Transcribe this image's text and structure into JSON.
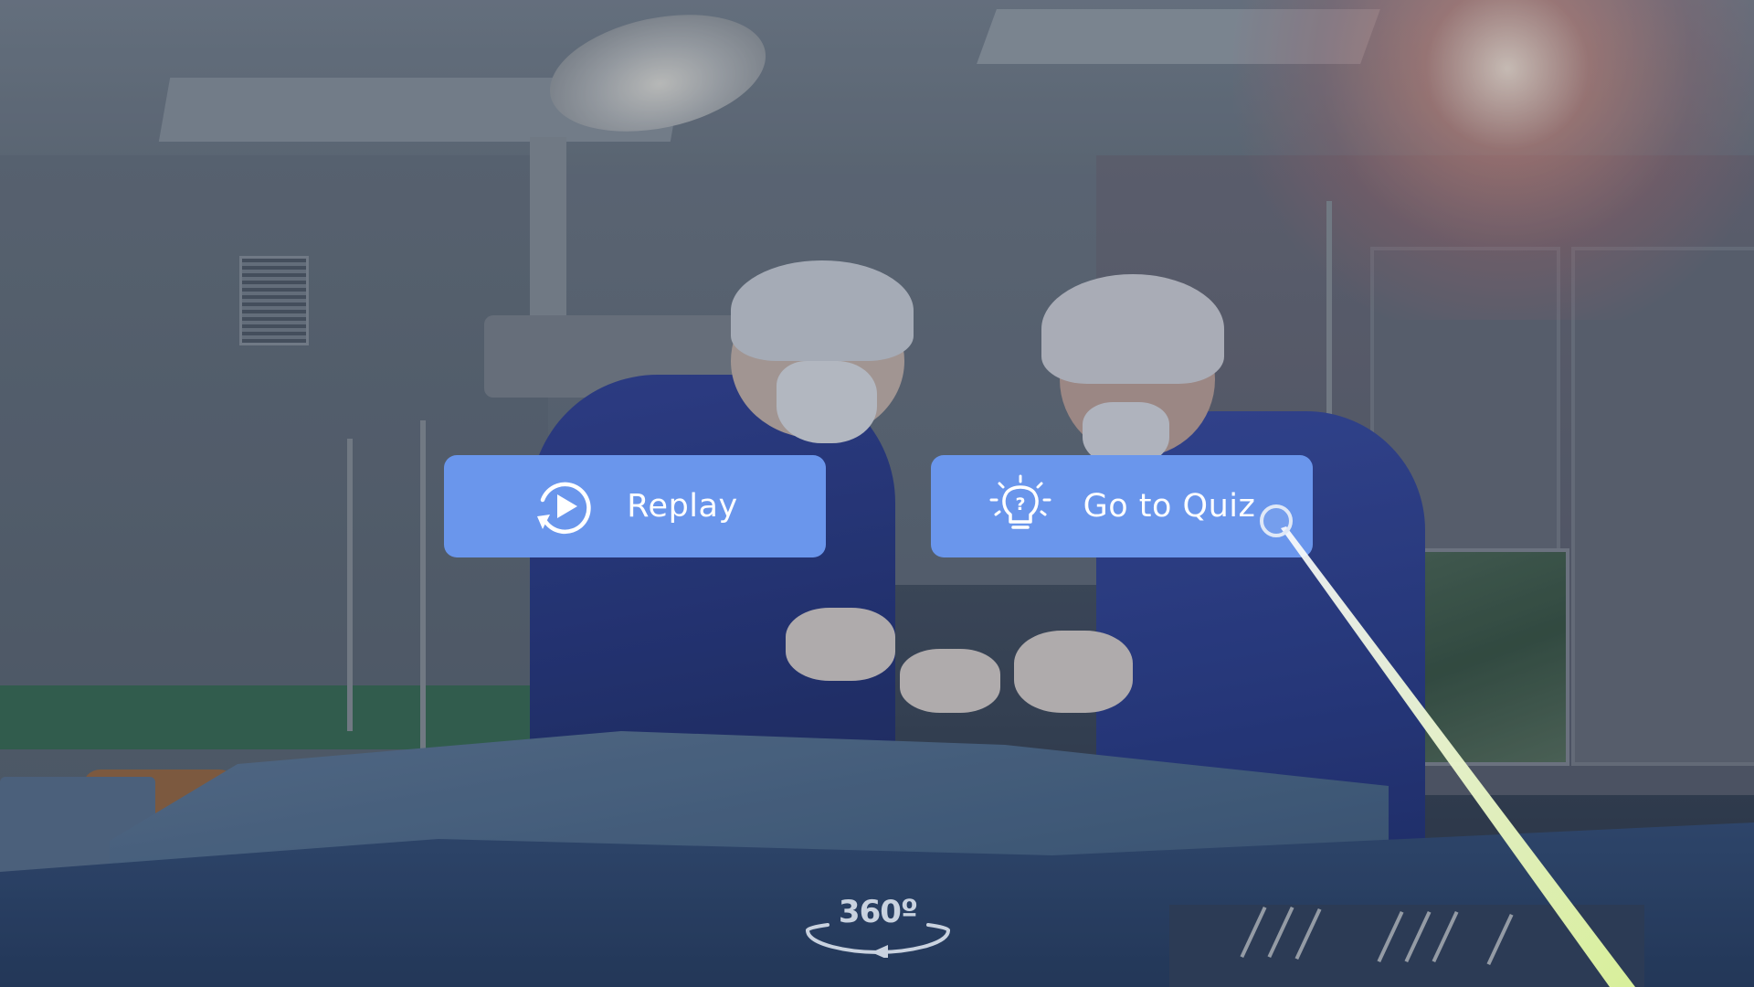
{
  "buttons": {
    "replay": {
      "label": "Replay",
      "icon": "replay-icon"
    },
    "quiz": {
      "label": "Go to Quiz",
      "icon": "lightbulb-question-icon"
    }
  },
  "view_badge": {
    "text": "360º",
    "icon": "rotate-360-icon"
  },
  "pointer": {
    "ray_color": "#e9f5c8",
    "ring_color": "#dfe8f7"
  },
  "colors": {
    "button_bg": "#6a96ec",
    "button_text": "#ffffff"
  },
  "background": {
    "scene": "surgical operating room with two surgeons"
  }
}
